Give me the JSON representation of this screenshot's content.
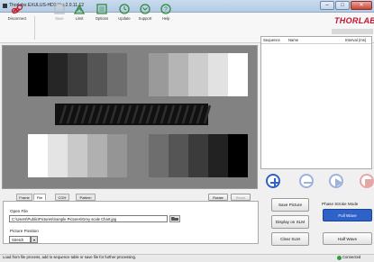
{
  "window": {
    "title": "Thorlabs EXULUS-HD3 Ver.2.0.11.12"
  },
  "toolbar": {
    "disconnect": "Disconnect",
    "save": "Save",
    "limit": "Limit",
    "options": "Options",
    "update": "Update",
    "support": "Support",
    "help": "Help"
  },
  "brand": {
    "logo": "THORLABS"
  },
  "sequence_table": {
    "col_sequence": "Sequence",
    "col_name": "Name",
    "col_interval": "Interval (ms)"
  },
  "image": {
    "top_left_gray": [
      "#000000",
      "#262626",
      "#3d3d3d",
      "#555555",
      "#6d6d6d"
    ],
    "top_right_gray": [
      "#9a9a9a",
      "#b5b5b5",
      "#cdcdcd",
      "#e2e2e2",
      "#ffffff"
    ],
    "bottom_left_gray": [
      "#ffffff",
      "#e4e4e4",
      "#c9c9c9",
      "#b0b0b0",
      "#959595"
    ],
    "bottom_right_gray": [
      "#6e6e6e",
      "#555555",
      "#3b3b3b",
      "#222222",
      "#000000"
    ]
  },
  "tabs": [
    "Frame",
    "File",
    "CGH",
    "Pattern"
  ],
  "active_tab": "File",
  "panel_buttons": {
    "rotate": "Rotate",
    "reset": "Reset"
  },
  "file_panel": {
    "open_file_label": "Open File",
    "path": "C:\\Users\\Public\\Pictures\\Sample Pictures\\Grey scale Chart.jpg",
    "position_label": "Picture Position",
    "position_value": "Stretch"
  },
  "actions": {
    "save_picture": "Save Picture",
    "display_on_slm": "Display on SLM",
    "clear_slm": "Clear SLM",
    "mode_label": "Phase Stroke Mode",
    "full_wave": "Full Wave",
    "half_wave": "Half Wave"
  },
  "status": {
    "message": "Load from file process, add to sequence table or save file for further processing.",
    "connection": "Connected"
  },
  "colors": {
    "accent_blue": "#2f62c9",
    "logo_red": "#c8102e",
    "connected_green": "#2e9e3c"
  }
}
